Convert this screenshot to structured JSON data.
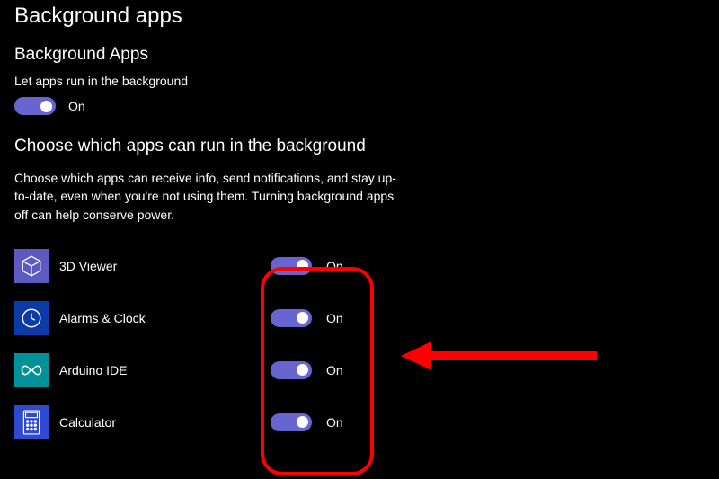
{
  "page_title": "Background apps",
  "section_apps_header": "Background Apps",
  "master_toggle": {
    "label": "Let apps run in the background",
    "state_label": "On",
    "on": true
  },
  "choose_header": "Choose which apps can run in the background",
  "description": "Choose which apps can receive info, send notifications, and stay up-to-date, even when you're not using them. Turning background apps off can help conserve power.",
  "apps": [
    {
      "name": "3D Viewer",
      "state_label": "On",
      "icon": "cube-icon"
    },
    {
      "name": "Alarms & Clock",
      "state_label": "On",
      "icon": "clock-icon"
    },
    {
      "name": "Arduino IDE",
      "state_label": "On",
      "icon": "infinity-icon"
    },
    {
      "name": "Calculator",
      "state_label": "On",
      "icon": "calculator-icon"
    }
  ],
  "colors": {
    "toggle_on": "#6865d0",
    "highlight": "#ff0000"
  }
}
